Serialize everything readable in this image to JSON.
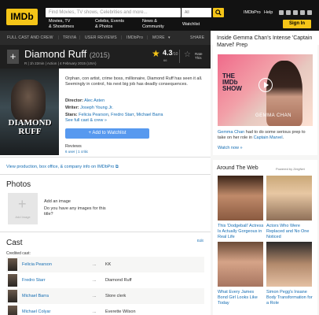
{
  "topbar": {
    "logo": "IMDb",
    "search_placeholder": "Find Movies, TV shows, Celebrities and more...",
    "search_category": "All",
    "nav": [
      {
        "line1": "Movies, TV",
        "line2": "& Showtimes"
      },
      {
        "line1": "Celebs, Events",
        "line2": "& Photos"
      },
      {
        "line1": "News &",
        "line2": "Community"
      },
      {
        "line1": "Watchlist",
        "line2": ""
      }
    ],
    "imdbpro": "IMDbPro",
    "help": "Help",
    "signin": "Sign In"
  },
  "subnav": {
    "items": [
      "FULL CAST AND CREW",
      "TRIVIA",
      "USER REVIEWS",
      "IMDbPro",
      "MORE"
    ],
    "share": "SHARE"
  },
  "title": {
    "name": "Diamond Ruff",
    "year": "(2015)",
    "meta": "R  |  1h 22min  |  Action  |  4 February 2015 (USA)",
    "rating": "4.3",
    "rating_scale": "/10",
    "rating_count": "66",
    "rate_label_1": "Rate",
    "rate_label_2": "This"
  },
  "poster": {
    "text_line1": "DIAMOND",
    "text_line2": "RUFF"
  },
  "overview": {
    "plot": "Orphan, con artist, crime boss, millionaire, Diamond Ruff has seen it all. Seemingly in control, his next big job has deadly consequences.",
    "director_label": "Director:",
    "director": "Alec Asten",
    "writer_label": "Writer:",
    "writer": "Joseph Young Jr.",
    "stars_label": "Stars:",
    "stars": [
      "Felicia Pearson",
      "Fredro Starr",
      "Michael Barra"
    ],
    "see_full": "See full cast & crew »",
    "watchlist": "+  Add to Watchlist",
    "reviews_label": "Reviews",
    "reviews_sub": "6 user  |  1 critic"
  },
  "probox": {
    "text": "View production, box office, & company info on IMDbPro ⧉"
  },
  "photos": {
    "heading": "Photos",
    "add_image_label": "Add Image",
    "add_title": "Add an image",
    "add_desc": "Do you have any images for this title?"
  },
  "cast": {
    "heading": "Cast",
    "edit": "Edit",
    "credited": "Credited cast:",
    "rows": [
      {
        "name": "Felicia Pearson",
        "dots": "...",
        "character": "KK"
      },
      {
        "name": "Fredro Starr",
        "dots": "...",
        "character": "Diamond Ruff"
      },
      {
        "name": "Michael Barra",
        "dots": "...",
        "character": "Store clerk"
      },
      {
        "name": "Michael Colyar",
        "dots": "...",
        "character": "Everette Wilson"
      }
    ]
  },
  "promo": {
    "title": "Inside Gemma Chan's Intense 'Captain Marvel' Prep",
    "show_text": "THE IMDb SHOW",
    "caption": "GEMMA CHAN",
    "desc_link": "Gemma Chan",
    "desc": " had to do some serious prep to take on her role in ",
    "desc_link2": "Captain Marvel",
    "desc_end": ".",
    "more": "Watch now »"
  },
  "around": {
    "heading": "Around The Web",
    "powered": "Powered by ZergNet",
    "tiles": [
      {
        "caption": "This 'Dodgeball' Actress Is Actually Gorgeous in Real Life"
      },
      {
        "caption": "Actors Who Were Replaced and No One Noticed"
      },
      {
        "caption": "What Every James Bond Girl Looks Like Today"
      },
      {
        "caption": "Simon Pegg's Insane Body Transformation for a Role"
      }
    ]
  },
  "colors": {
    "imdb_yellow": "#f5c518",
    "link_blue": "#136cb2",
    "watchlist_blue": "#5799ef",
    "dark_bg": "#121212"
  }
}
